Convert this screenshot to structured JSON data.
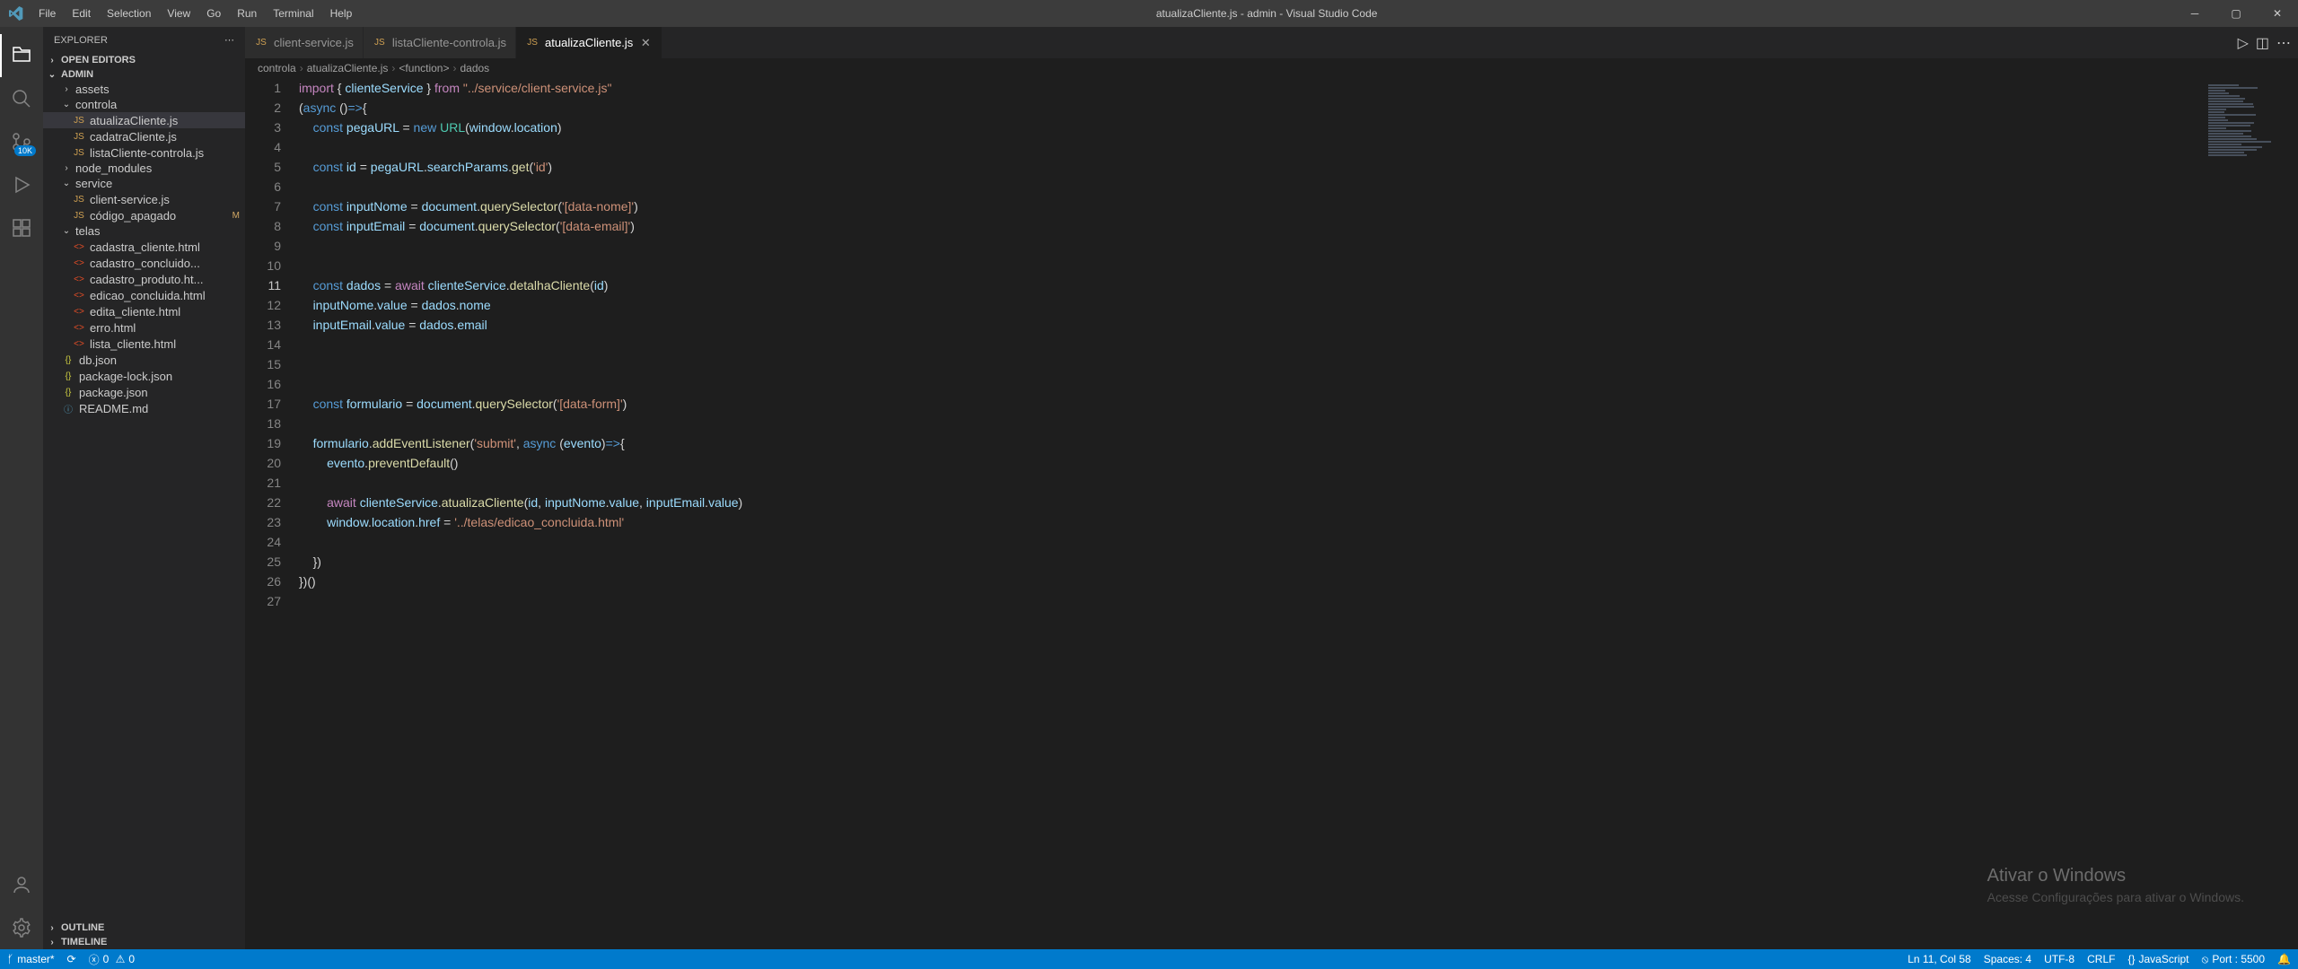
{
  "titlebar": {
    "title": "atualizaCliente.js - admin - Visual Studio Code",
    "menu": [
      "File",
      "Edit",
      "Selection",
      "View",
      "Go",
      "Run",
      "Terminal",
      "Help"
    ]
  },
  "activity": {
    "scm_badge": "10K"
  },
  "sidebar": {
    "title": "EXPLORER",
    "sections": {
      "open_editors": "OPEN EDITORS",
      "project": "ADMIN",
      "outline": "OUTLINE",
      "timeline": "TIMELINE"
    },
    "tree": {
      "assets": "assets",
      "controla": "controla",
      "controla_items": [
        {
          "label": "atualizaCliente.js",
          "selected": true,
          "icon": "JS",
          "color": "js-color"
        },
        {
          "label": "cadatraCliente.js",
          "icon": "JS",
          "color": "js-color"
        },
        {
          "label": "listaCliente-controla.js",
          "icon": "JS",
          "color": "js-color"
        }
      ],
      "node_modules": "node_modules",
      "service": "service",
      "service_items": [
        {
          "label": "client-service.js",
          "icon": "JS",
          "color": "js-color"
        },
        {
          "label": "código_apagado",
          "icon": "JS",
          "color": "js-color",
          "git": "M"
        }
      ],
      "telas": "telas",
      "telas_items": [
        {
          "label": "cadastra_cliente.html",
          "icon": "<>",
          "color": "html-color"
        },
        {
          "label": "cadastro_concluido...",
          "icon": "<>",
          "color": "html-color"
        },
        {
          "label": "cadastro_produto.ht...",
          "icon": "<>",
          "color": "html-color"
        },
        {
          "label": "edicao_concluida.html",
          "icon": "<>",
          "color": "html-color"
        },
        {
          "label": "edita_cliente.html",
          "icon": "<>",
          "color": "html-color"
        },
        {
          "label": "erro.html",
          "icon": "<>",
          "color": "html-color"
        },
        {
          "label": "lista_cliente.html",
          "icon": "<>",
          "color": "html-color"
        }
      ],
      "root_items": [
        {
          "label": "db.json",
          "icon": "{}",
          "color": "json-color"
        },
        {
          "label": "package-lock.json",
          "icon": "{}",
          "color": "json-color"
        },
        {
          "label": "package.json",
          "icon": "{}",
          "color": "json-color"
        },
        {
          "label": "README.md",
          "icon": "ⓘ",
          "color": "readme-color"
        }
      ]
    }
  },
  "tabs": [
    {
      "label": "client-service.js",
      "icon": "JS",
      "active": false
    },
    {
      "label": "listaCliente-controla.js",
      "icon": "JS",
      "active": false
    },
    {
      "label": "atualizaCliente.js",
      "icon": "JS",
      "active": true
    }
  ],
  "breadcrumb": [
    "controla",
    "atualizaCliente.js",
    "<function>",
    "dados"
  ],
  "code_lines": [
    "<span class='kw'>import</span> <span class='pun'>{</span> <span class='var'>clienteService</span> <span class='pun'>}</span> <span class='kw'>from</span> <span class='str'>\"../service/client-service.js\"</span>",
    "<span class='pun'>(</span><span class='kw2'>async</span> <span class='pun'>()</span><span class='kw2'>=&gt;</span><span class='pun'>{</span>",
    "    <span class='kw2'>const</span> <span class='var'>pegaURL</span> <span class='pun'>=</span> <span class='kw2'>new</span> <span class='cls'>URL</span><span class='pun'>(</span><span class='var'>window</span><span class='pun'>.</span><span class='var'>location</span><span class='pun'>)</span>",
    "",
    "    <span class='kw2'>const</span> <span class='var'>id</span> <span class='pun'>=</span> <span class='var'>pegaURL</span><span class='pun'>.</span><span class='var'>searchParams</span><span class='pun'>.</span><span class='fn'>get</span><span class='pun'>(</span><span class='str'>'id'</span><span class='pun'>)</span>",
    "",
    "    <span class='kw2'>const</span> <span class='var'>inputNome</span> <span class='pun'>=</span> <span class='var'>document</span><span class='pun'>.</span><span class='fn'>querySelector</span><span class='pun'>(</span><span class='str'>'[data-nome]'</span><span class='pun'>)</span>",
    "    <span class='kw2'>const</span> <span class='var'>inputEmail</span> <span class='pun'>=</span> <span class='var'>document</span><span class='pun'>.</span><span class='fn'>querySelector</span><span class='pun'>(</span><span class='str'>'[data-email]'</span><span class='pun'>)</span>",
    "",
    "",
    "    <span class='kw2'>const</span> <span class='var'>dados</span> <span class='pun'>=</span> <span class='kw'>await</span> <span class='var'>clienteService</span><span class='pun'>.</span><span class='fn'>detalhaCliente</span><span class='pun'>(</span><span class='var'>id</span><span class='pun'>)</span>",
    "    <span class='var'>inputNome</span><span class='pun'>.</span><span class='var'>value</span> <span class='pun'>=</span> <span class='var'>dados</span><span class='pun'>.</span><span class='var'>nome</span>",
    "    <span class='var'>inputEmail</span><span class='pun'>.</span><span class='var'>value</span> <span class='pun'>=</span> <span class='var'>dados</span><span class='pun'>.</span><span class='var'>email</span>",
    "",
    "",
    "",
    "    <span class='kw2'>const</span> <span class='var'>formulario</span> <span class='pun'>=</span> <span class='var'>document</span><span class='pun'>.</span><span class='fn'>querySelector</span><span class='pun'>(</span><span class='str'>'[data-form]'</span><span class='pun'>)</span>",
    "",
    "    <span class='var'>formulario</span><span class='pun'>.</span><span class='fn'>addEventListener</span><span class='pun'>(</span><span class='str'>'submit'</span><span class='pun'>,</span> <span class='kw2'>async</span> <span class='pun'>(</span><span class='var'>evento</span><span class='pun'>)</span><span class='kw2'>=&gt;</span><span class='pun'>{</span>",
    "        <span class='var'>evento</span><span class='pun'>.</span><span class='fn'>preventDefault</span><span class='pun'>()</span>",
    "",
    "        <span class='kw'>await</span> <span class='var'>clienteService</span><span class='pun'>.</span><span class='fn'>atualizaCliente</span><span class='pun'>(</span><span class='var'>id</span><span class='pun'>,</span> <span class='var'>inputNome</span><span class='pun'>.</span><span class='var'>value</span><span class='pun'>,</span> <span class='var'>inputEmail</span><span class='pun'>.</span><span class='var'>value</span><span class='pun'>)</span>",
    "        <span class='var'>window</span><span class='pun'>.</span><span class='var'>location</span><span class='pun'>.</span><span class='var'>href</span> <span class='pun'>=</span> <span class='str'>'../telas/edicao_concluida.html'</span>",
    "",
    "    <span class='pun'>})</span>",
    "<span class='pun'>})()</span>",
    ""
  ],
  "current_line": 11,
  "statusbar": {
    "branch": "master*",
    "sync": "⟳",
    "errors": "0",
    "warnings": "0",
    "ln_col": "Ln 11, Col 58",
    "spaces": "Spaces: 4",
    "encoding": "UTF-8",
    "eol": "CRLF",
    "language": "JavaScript",
    "port": "Port : 5500"
  },
  "watermark": {
    "title": "Ativar o Windows",
    "sub": "Acesse Configurações para ativar o Windows."
  }
}
